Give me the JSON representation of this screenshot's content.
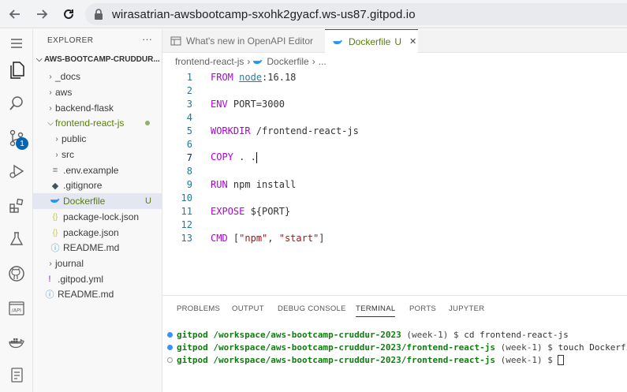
{
  "browser": {
    "url": "wirasatrian-awsbootcamp-sxohk2gyacf.ws-us87.gitpod.io"
  },
  "activity": {
    "scm_badge": "1"
  },
  "explorer": {
    "title": "EXPLORER",
    "more": "···",
    "root": "AWS-BOOTCAMP-CRUDDUR...",
    "items": [
      {
        "label": "_docs",
        "kind": "folder",
        "open": false
      },
      {
        "label": "aws",
        "kind": "folder",
        "open": false
      },
      {
        "label": "backend-flask",
        "kind": "folder",
        "open": false
      },
      {
        "label": "frontend-react-js",
        "kind": "folder",
        "open": true
      },
      {
        "label": "public",
        "kind": "folder",
        "open": false
      },
      {
        "label": "src",
        "kind": "folder",
        "open": false
      },
      {
        "label": ".env.example",
        "kind": "file"
      },
      {
        "label": ".gitignore",
        "kind": "file"
      },
      {
        "label": "Dockerfile",
        "kind": "file",
        "status": "U"
      },
      {
        "label": "package-lock.json",
        "kind": "file"
      },
      {
        "label": "package.json",
        "kind": "file"
      },
      {
        "label": "README.md",
        "kind": "file"
      },
      {
        "label": "journal",
        "kind": "folder",
        "open": false
      },
      {
        "label": ".gitpod.yml",
        "kind": "file"
      },
      {
        "label": "README.md",
        "kind": "file"
      }
    ]
  },
  "tabs": [
    {
      "label": "What's new in OpenAPI Editor"
    },
    {
      "label": "Dockerfile",
      "status": "U",
      "close": "✕"
    }
  ],
  "breadcrumb": {
    "folder": "frontend-react-js",
    "file": "Dockerfile",
    "tail": "..."
  },
  "editor": {
    "line_numbers": [
      "1",
      "2",
      "3",
      "4",
      "5",
      "6",
      "7",
      "8",
      "9",
      "10",
      "11",
      "12",
      "13"
    ],
    "current_line": "7",
    "lines": {
      "l1_kw": "FROM",
      "l1_img": "node",
      "l1_rest": ":16.18",
      "l3_kw": "ENV",
      "l3_rest": " PORT=3000",
      "l5_kw": "WORKDIR",
      "l5_rest": " /frontend-react-js",
      "l7_kw": "COPY",
      "l7_rest": " . .",
      "l9_kw": "RUN",
      "l9_rest": " npm install",
      "l11_kw": "EXPOSE",
      "l11_rest": " ${PORT}",
      "l13_kw": "CMD",
      "l13_open": " [",
      "l13_s1": "\"npm\"",
      "l13_comma": ", ",
      "l13_s2": "\"start\"",
      "l13_close": "]"
    }
  },
  "panel": {
    "tabs": [
      "PROBLEMS",
      "OUTPUT",
      "DEBUG CONSOLE",
      "TERMINAL",
      "PORTS",
      "JUPYTER"
    ],
    "active_tab": "TERMINAL",
    "terminal": [
      {
        "user": "gitpod",
        "path": "/workspace/aws-bootcamp-cruddur-2023",
        "git": " (week-1) $ ",
        "cmd": "cd frontend-react-js",
        "status": "done"
      },
      {
        "user": "gitpod",
        "path": "/workspace/aws-bootcamp-cruddur-2023/frontend-react-js",
        "git": " (week-1) $ ",
        "cmd": "touch Dockerfile",
        "status": "done"
      },
      {
        "user": "gitpod",
        "path": "/workspace/aws-bootcamp-cruddur-2023/frontend-react-js",
        "git": " (week-1) $ ",
        "cmd": "",
        "status": "pending"
      }
    ]
  },
  "colors": {
    "accent": "#005fb8",
    "badge": "#0066b8",
    "keyword": "#af00db",
    "string": "#a31515",
    "prompt": "#107c10",
    "untracked": "#587c0c"
  }
}
